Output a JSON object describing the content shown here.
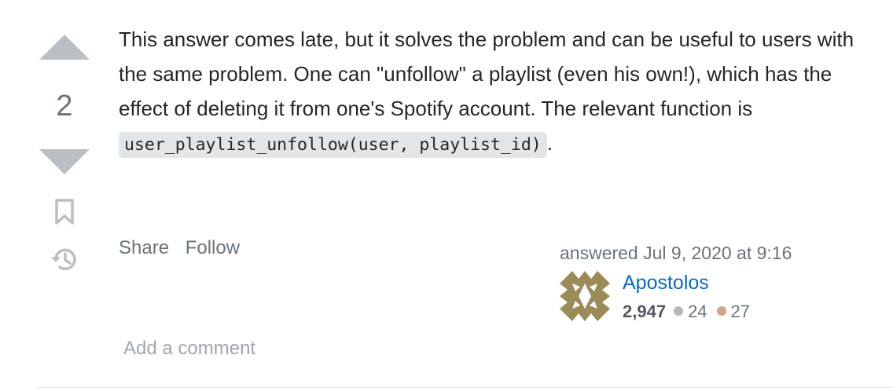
{
  "vote": {
    "count": "2"
  },
  "answer": {
    "text_before": "This answer comes late, but it solves the problem and can be useful to users with the same problem. One can \"unfollow\" a playlist (even his own!), which has the effect of deleting it from one's Spotify account. The relevant function is ",
    "code": "user_playlist_unfollow(user, playlist_id)",
    "text_after": "."
  },
  "post_menu": {
    "share_label": "Share",
    "follow_label": "Follow"
  },
  "user_card": {
    "action_time": "answered Jul 9, 2020 at 9:16",
    "user_name": "Apostolos",
    "reputation": "2,947",
    "silver_badges": "24",
    "bronze_badges": "27"
  },
  "comments": {
    "add_comment_label": "Add a comment"
  },
  "colors": {
    "link": "#0a68c4",
    "silver_badge": "#b4b8bc",
    "bronze_badge": "#d1a684",
    "avatar": "#9b8b58"
  },
  "icons": [
    "upvote-arrow-icon",
    "downvote-arrow-icon",
    "bookmark-icon",
    "history-icon",
    "identicon-avatar"
  ]
}
